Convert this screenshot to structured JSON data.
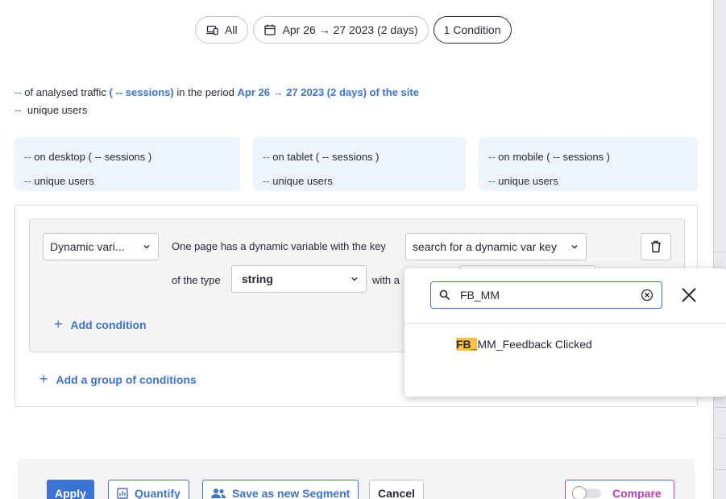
{
  "filters": {
    "device": "All",
    "date_range": "Apr 26 → 27 2023 (2 days)",
    "conditions": "1 Condition"
  },
  "summary": {
    "traffic_value": "--",
    "traffic_text": " of analysed traffic ",
    "sessions": "( -- sessions)",
    "period_text": " in the period ",
    "period": "Apr 26 → 27 2023 (2 days) of the site",
    "users_value": "--",
    "users_text": "  unique users"
  },
  "devices": [
    {
      "value": "--",
      "label": " on desktop ( -- sessions )",
      "users_value": "--",
      "users_label": " unique users"
    },
    {
      "value": "--",
      "label": " on tablet ( -- sessions )",
      "users_value": "--",
      "users_label": " unique users"
    },
    {
      "value": "--",
      "label": " on mobile ( -- sessions )",
      "users_value": "--",
      "users_label": " unique users"
    }
  ],
  "condition": {
    "type_select": "Dynamic vari...",
    "text_key": "One page has a dynamic variable with the key",
    "key_select": "search for a dynamic var key",
    "text_type": "of the type",
    "type_value": "string",
    "text_with": "with a",
    "add_condition": "Add condition",
    "add_group": "Add a group of conditions"
  },
  "dropdown": {
    "search_value": "FB_MM",
    "result_highlight": "FB_",
    "result_rest": "MM_Feedback Clicked"
  },
  "footer": {
    "apply": "Apply",
    "quantify": "Quantify",
    "save_segment": "Save as new Segment",
    "cancel": "Cancel",
    "compare": "Compare"
  },
  "colors": {
    "accent": "#3b73d6",
    "highlight": "#f6c24a",
    "compare": "#c13ab5",
    "device_card_bg": "#eef4fc"
  }
}
